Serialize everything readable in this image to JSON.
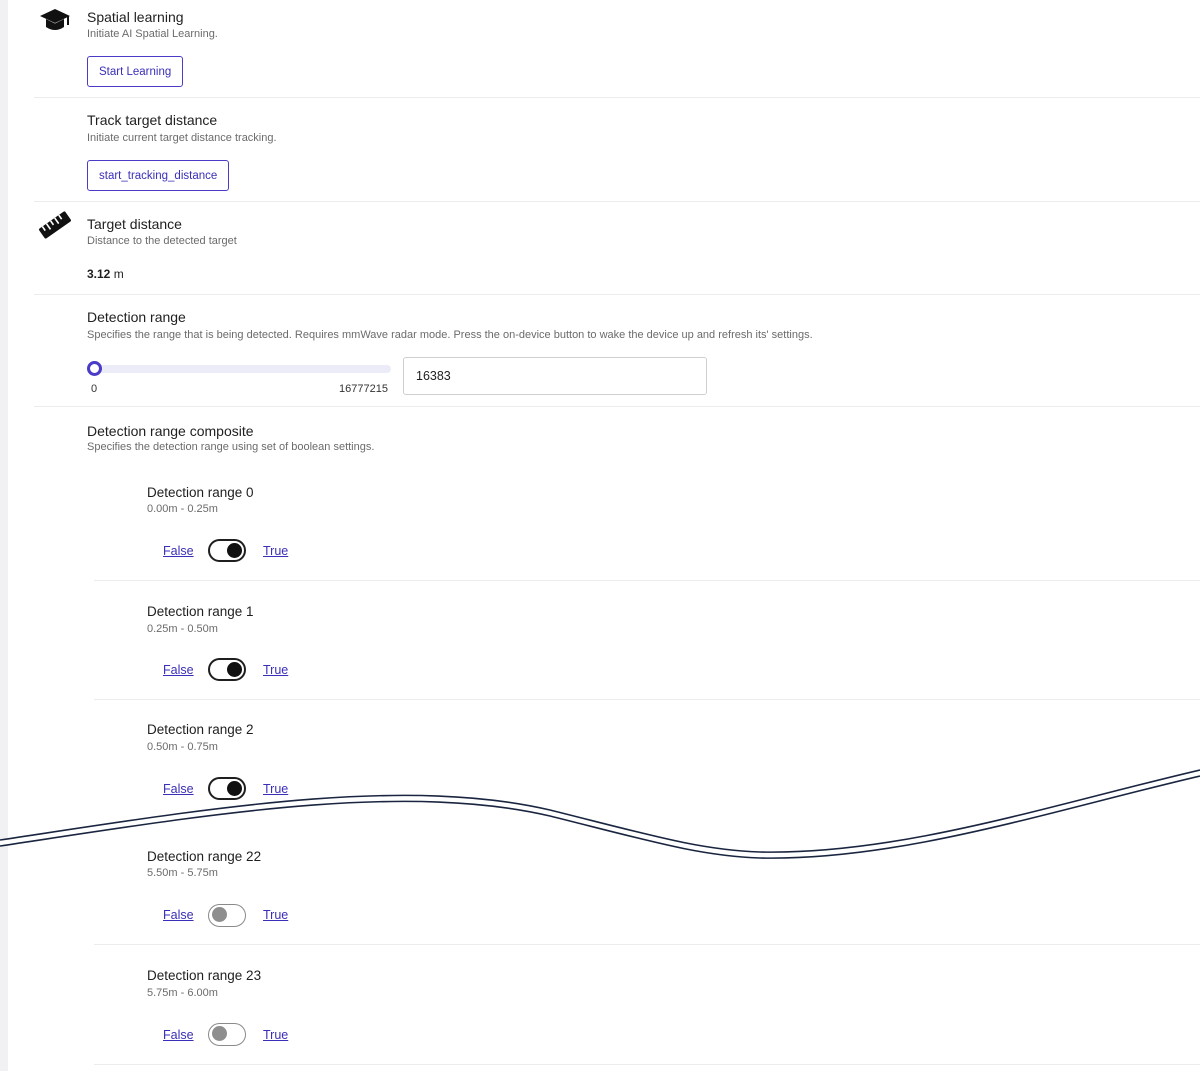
{
  "spatial_learning": {
    "icon": "graduation-cap-icon",
    "title": "Spatial learning",
    "subtitle": "Initiate AI Spatial Learning.",
    "button_label": "Start Learning"
  },
  "track_target_distance": {
    "title": "Track target distance",
    "subtitle": "Initiate current target distance tracking.",
    "button_label": "start_tracking_distance"
  },
  "target_distance": {
    "icon": "ruler-icon",
    "title": "Target distance",
    "subtitle": "Distance to the detected target",
    "value": "3.12",
    "unit": "m"
  },
  "detection_range": {
    "title": "Detection range",
    "subtitle": "Specifies the range that is being detected. Requires mmWave radar mode. Press the on-device button to wake the device up and refresh its' settings.",
    "min_label": "0",
    "max_label": "16777215",
    "value": "16383",
    "slider_fraction": 0.001
  },
  "detection_range_composite": {
    "title": "Detection range composite",
    "subtitle": "Specifies the detection range using set of boolean settings.",
    "items": [
      {
        "title": "Detection range 0",
        "range": "0.00m - 0.25m",
        "false_label": "False",
        "true_label": "True",
        "value": true
      },
      {
        "title": "Detection range 1",
        "range": "0.25m - 0.50m",
        "false_label": "False",
        "true_label": "True",
        "value": true
      },
      {
        "title": "Detection range 2",
        "range": "0.50m - 0.75m",
        "false_label": "False",
        "true_label": "True",
        "value": true
      },
      {
        "title": "Detection range 22",
        "range": "5.50m - 5.75m",
        "false_label": "False",
        "true_label": "True",
        "value": false
      },
      {
        "title": "Detection range 23",
        "range": "5.75m - 6.00m",
        "false_label": "False",
        "true_label": "True",
        "value": false
      }
    ]
  },
  "colors": {
    "accent": "#4a3cc7",
    "link": "#3a2fb8",
    "break_line": "#1a2540"
  }
}
